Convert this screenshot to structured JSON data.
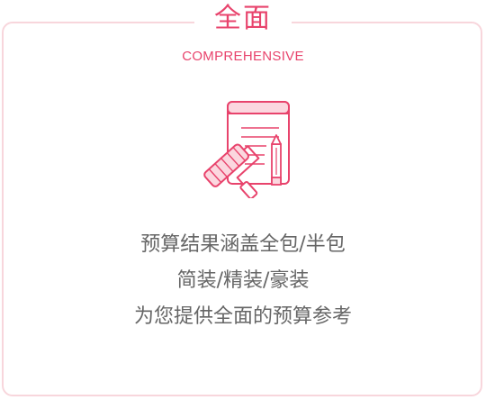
{
  "feature": {
    "title": "全面",
    "subtitle": "COMPREHENSIVE",
    "icon": "renovation-plan-icon",
    "lines": [
      "预算结果涵盖全包/半包",
      "简装/精装/豪装",
      "为您提供全面的预算参考"
    ]
  },
  "colors": {
    "accent": "#e8436c",
    "border": "#f8d6dc",
    "text": "#666666"
  }
}
